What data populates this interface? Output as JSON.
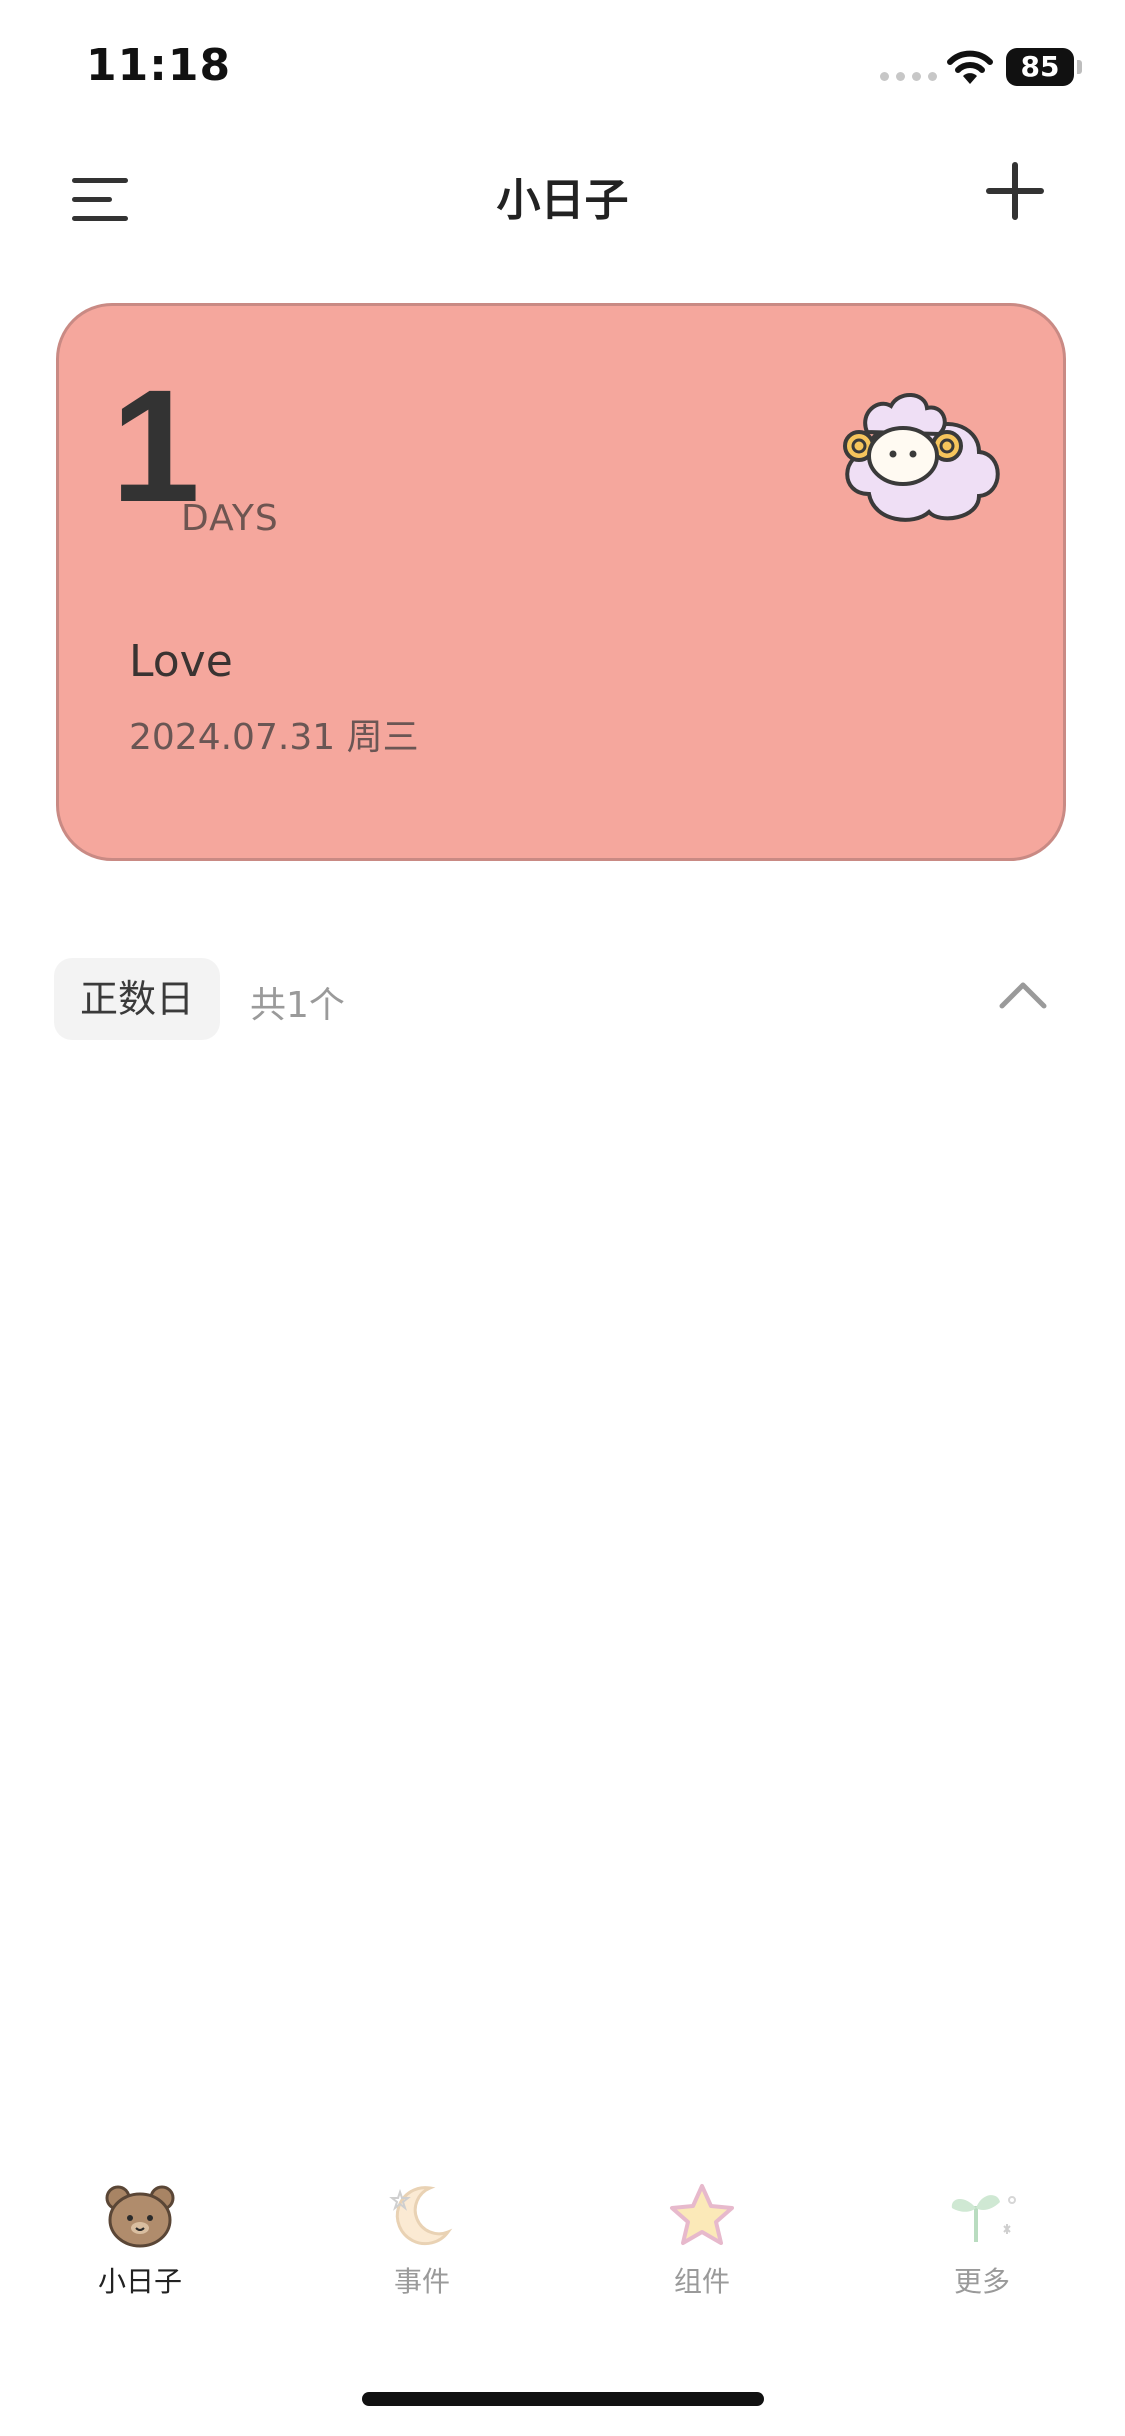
{
  "status_bar": {
    "time": "11:18",
    "battery": "85"
  },
  "nav": {
    "title": "小日子"
  },
  "card": {
    "days_number": "1",
    "days_unit": "DAYS",
    "event_title": "Love",
    "event_date": "2024.07.31 周三",
    "background_color": "#f5a79d",
    "icon": "sheep-icon"
  },
  "section": {
    "chip_label": "正数日",
    "count_label": "共1个"
  },
  "tabs": [
    {
      "label": "小日子",
      "icon": "bear-icon",
      "active": true
    },
    {
      "label": "事件",
      "icon": "moon-icon",
      "active": false
    },
    {
      "label": "组件",
      "icon": "star-icon",
      "active": false
    },
    {
      "label": "更多",
      "icon": "sprout-icon",
      "active": false
    }
  ]
}
